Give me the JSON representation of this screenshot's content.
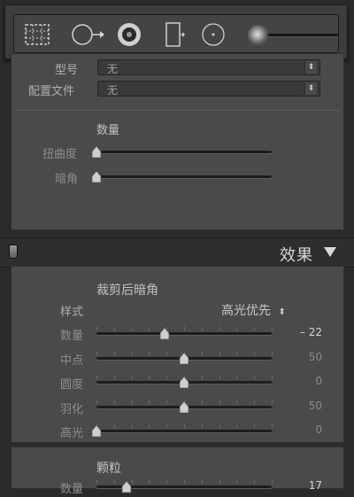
{
  "toolbar": {
    "tools": [
      {
        "icon": "crop-overlay-icon"
      },
      {
        "icon": "spot-removal-icon"
      },
      {
        "icon": "red-eye-icon"
      },
      {
        "icon": "graduated-filter-icon"
      },
      {
        "icon": "radial-filter-icon"
      },
      {
        "icon": "adjustment-brush-icon"
      }
    ],
    "slider_level": 0.1
  },
  "lens": {
    "model_label": "型号",
    "model_value": "无",
    "profile_label": "配置文件",
    "profile_value": "无",
    "amount_title": "数量",
    "sliders": [
      {
        "label": "扭曲度",
        "level": 0.0
      },
      {
        "label": "暗角",
        "level": 0.0
      }
    ]
  },
  "effects": {
    "title": "效果",
    "vignette": {
      "title": "裁剪后暗角",
      "style_label": "样式",
      "style_value": "高光优先",
      "sliders": [
        {
          "label": "数量",
          "value": "– 22",
          "level": 0.39,
          "bright": true
        },
        {
          "label": "中点",
          "value": "50",
          "level": 0.5
        },
        {
          "label": "圆度",
          "value": "0",
          "level": 0.5
        },
        {
          "label": "羽化",
          "value": "50",
          "level": 0.5
        },
        {
          "label": "高光",
          "value": "0",
          "level": 0.0
        }
      ]
    },
    "grain": {
      "title": "颗粒",
      "sliders": [
        {
          "label": "数量",
          "value": "17",
          "level": 0.17,
          "bright": true
        }
      ]
    }
  }
}
